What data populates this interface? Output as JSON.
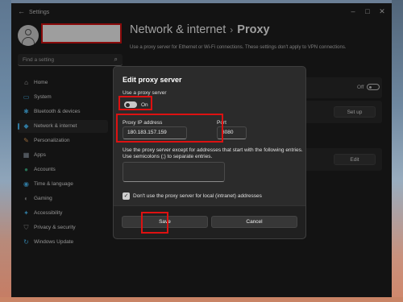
{
  "window": {
    "title": "Settings"
  },
  "search": {
    "placeholder": "Find a setting"
  },
  "sidebar": {
    "items": [
      {
        "label": "Home",
        "icon": "home-icon",
        "glyph": "⌂",
        "color": "#cfcfcf"
      },
      {
        "label": "System",
        "icon": "system-icon",
        "glyph": "▭",
        "color": "#4cc2ff"
      },
      {
        "label": "Bluetooth & devices",
        "icon": "bluetooth-icon",
        "glyph": "✱",
        "color": "#4cc2ff"
      },
      {
        "label": "Network & internet",
        "icon": "network-icon",
        "glyph": "◆",
        "color": "#4cc2ff",
        "active": true
      },
      {
        "label": "Personalization",
        "icon": "brush-icon",
        "glyph": "✎",
        "color": "#e8a25b"
      },
      {
        "label": "Apps",
        "icon": "apps-icon",
        "glyph": "▦",
        "color": "#a9b7c6"
      },
      {
        "label": "Accounts",
        "icon": "accounts-icon",
        "glyph": "●",
        "color": "#3fb68b"
      },
      {
        "label": "Time & language",
        "icon": "globe-icon",
        "glyph": "◉",
        "color": "#4cc2ff"
      },
      {
        "label": "Gaming",
        "icon": "gaming-icon",
        "glyph": "◐",
        "color": "#9a9a9a"
      },
      {
        "label": "Accessibility",
        "icon": "accessibility-icon",
        "glyph": "✦",
        "color": "#4cc2ff"
      },
      {
        "label": "Privacy & security",
        "icon": "shield-icon",
        "glyph": "⛉",
        "color": "#9a9a9a"
      },
      {
        "label": "Windows Update",
        "icon": "update-icon",
        "glyph": "↻",
        "color": "#4cc2ff"
      }
    ]
  },
  "header": {
    "section": "Network & internet",
    "separator": "›",
    "page": "Proxy",
    "description": "Use a proxy server for Ethernet or Wi-Fi connections. These settings don't apply to VPN connections."
  },
  "background": {
    "off_label": "Off",
    "setup_label": "Set up",
    "edit_label": "Edit"
  },
  "dialog": {
    "title": "Edit proxy server",
    "use_proxy_label": "Use a proxy server",
    "toggle_state": "On",
    "ip_label": "Proxy IP address",
    "ip_value": "180.183.157.159",
    "port_label": "Port",
    "port_value": "8080",
    "exceptions_text_1": "Use the proxy server except for addresses that start with the following entries.",
    "exceptions_text_2": "Use semicolons (;) to separate entries.",
    "local_checkbox_label": "Don't use the proxy server for local (intranet) addresses",
    "save_label": "Save",
    "cancel_label": "Cancel"
  },
  "colors": {
    "accent": "#4cc2ff",
    "highlight": "#dd1111"
  }
}
